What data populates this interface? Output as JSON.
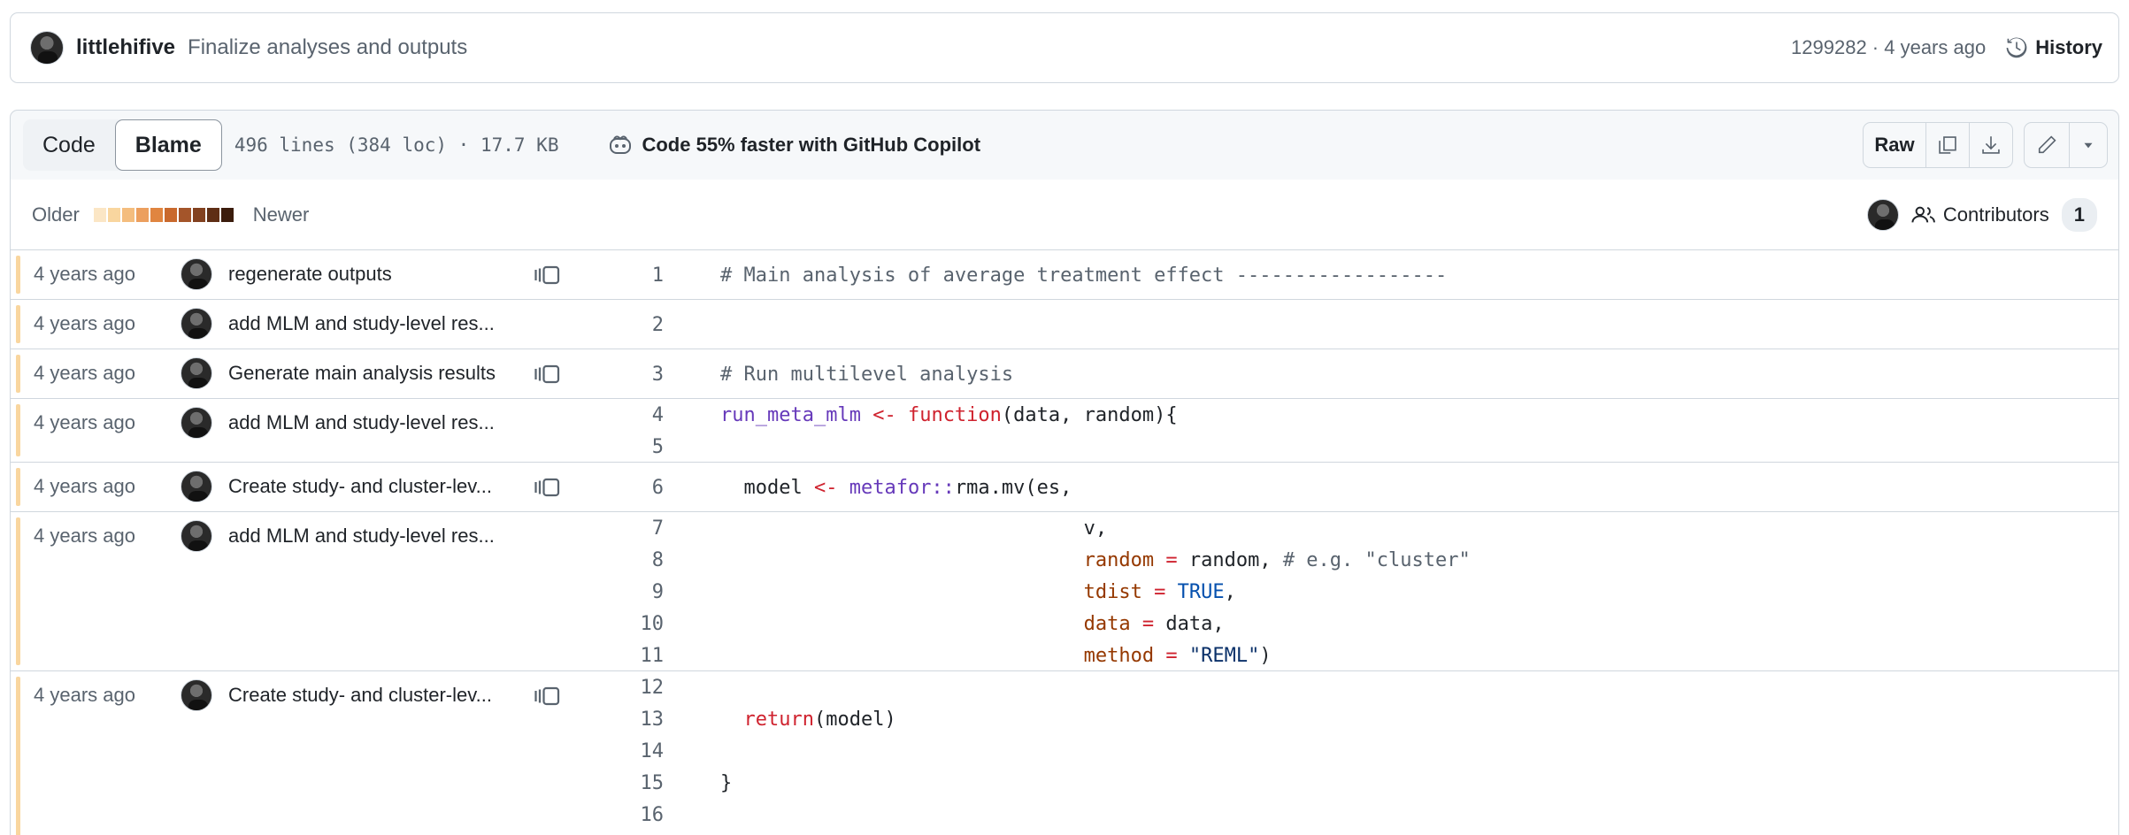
{
  "commit": {
    "author": "littlehifive",
    "message": "Finalize analyses and outputs",
    "meta": "1299282 · 4 years ago",
    "history_label": "History"
  },
  "file_header": {
    "code_tab": "Code",
    "blame_tab": "Blame",
    "file_info": "496 lines (384 loc) · 17.7 KB",
    "copilot_text": "Code 55% faster with GitHub Copilot",
    "raw_label": "Raw"
  },
  "legend": {
    "older": "Older",
    "newer": "Newer",
    "swatch_colors": [
      "#fbe6c5",
      "#f9d69f",
      "#f4bd7e",
      "#ec9f5e",
      "#e08540",
      "#c9692d",
      "#a4552a",
      "#82411f",
      "#5f2e15",
      "#3b1c0c"
    ],
    "contributors_label": "Contributors",
    "contributors_count": "1"
  },
  "accent_colors": {
    "age_strip": "#f9d69f",
    "border": "#d0d7de"
  },
  "hunks": [
    {
      "date": "4 years ago",
      "message": "regenerate outputs",
      "reblame": true
    },
    {
      "date": "4 years ago",
      "message": "add MLM and study-level res...",
      "reblame": false
    },
    {
      "date": "4 years ago",
      "message": "Generate main analysis results",
      "reblame": true
    },
    {
      "date": "4 years ago",
      "message": "add MLM and study-level res...",
      "reblame": false
    },
    {
      "date": "4 years ago",
      "message": "Create study- and cluster-lev...",
      "reblame": true
    },
    {
      "date": "4 years ago",
      "message": "add MLM and study-level res...",
      "reblame": false
    },
    {
      "date": "4 years ago",
      "message": "Create study- and cluster-lev...",
      "reblame": true
    }
  ],
  "lines": [
    {
      "n": "1",
      "text": "# Main analysis of average treatment effect ------------------"
    },
    {
      "n": "2",
      "text": ""
    },
    {
      "n": "3",
      "text": "# Run multilevel analysis"
    },
    {
      "n": "4",
      "text": "run_meta_mlm <- function(data, random){"
    },
    {
      "n": "5",
      "text": ""
    },
    {
      "n": "6",
      "text": "  model <- metafor::rma.mv(es,"
    },
    {
      "n": "7",
      "text": "                               v,"
    },
    {
      "n": "8",
      "text": "                               random = random, # e.g. \"cluster\""
    },
    {
      "n": "9",
      "text": "                               tdist = TRUE,"
    },
    {
      "n": "10",
      "text": "                               data = data,"
    },
    {
      "n": "11",
      "text": "                               method = \"REML\")"
    },
    {
      "n": "12",
      "text": ""
    },
    {
      "n": "13",
      "text": "  return(model)"
    },
    {
      "n": "14",
      "text": ""
    },
    {
      "n": "15",
      "text": "}"
    },
    {
      "n": "16",
      "text": ""
    }
  ]
}
